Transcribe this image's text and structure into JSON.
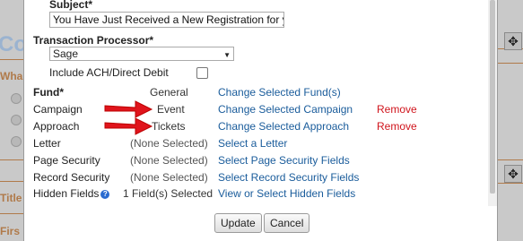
{
  "background": {
    "left_heading_fragment": "Co",
    "left_question_fragment": "Wha",
    "title_fragment": "Title",
    "first_fragment": "Firs"
  },
  "form": {
    "subject_label": "Subject*",
    "subject_value": "You Have Just Received a New Registration for yo",
    "processor_label": "Transaction Processor*",
    "processor_value": "Sage",
    "ach_label": "Include ACH/Direct Debit"
  },
  "rows": [
    {
      "label": "Fund*",
      "value": "General",
      "link": "Change Selected Fund(s)",
      "remove": ""
    },
    {
      "label": "Campaign",
      "value": "Event",
      "link": "Change Selected Campaign",
      "remove": "Remove"
    },
    {
      "label": "Approach",
      "value": "Tickets",
      "link": "Change Selected Approach",
      "remove": "Remove"
    },
    {
      "label": "Letter",
      "value": "(None Selected)",
      "link": "Select a Letter",
      "remove": ""
    },
    {
      "label": "Page Security",
      "value": "(None Selected)",
      "link": "Select Page Security Fields",
      "remove": ""
    },
    {
      "label": "Record Security",
      "value": "(None Selected)",
      "link": "Select Record Security Fields",
      "remove": ""
    },
    {
      "label": "Hidden Fields",
      "value": "1 Field(s) Selected",
      "link": "View or Select Hidden Fields",
      "remove": ""
    }
  ],
  "buttons": {
    "update": "Update",
    "cancel": "Cancel"
  },
  "colors": {
    "link": "#1a5c9b",
    "remove": "#d0141c",
    "arrow": "#e0141c"
  }
}
